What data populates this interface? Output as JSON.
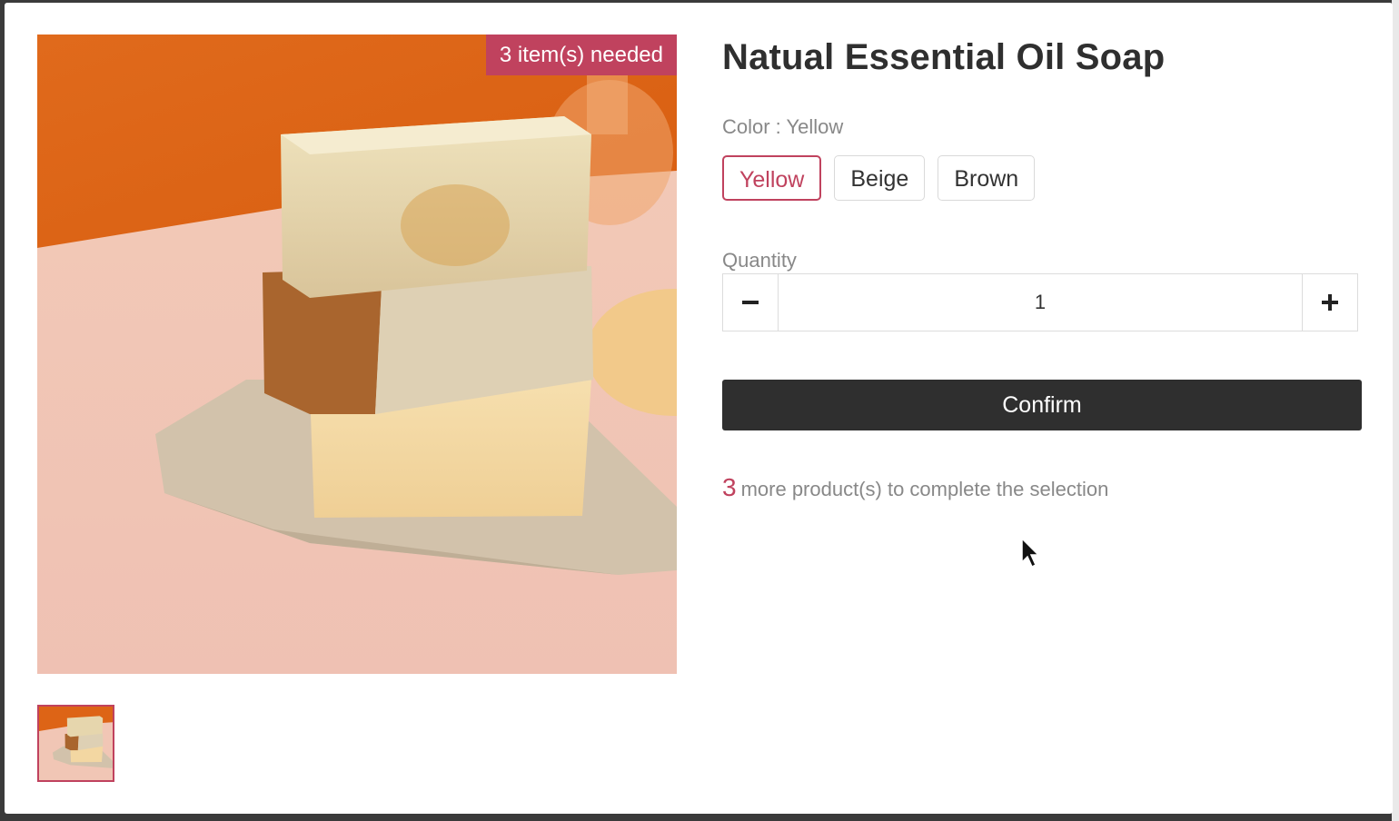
{
  "product": {
    "title": "Natual Essential Oil Soap",
    "badge": "3 item(s) needed",
    "image_alt": "soap-stack-image"
  },
  "color": {
    "label": "Color : Yellow",
    "options": [
      "Yellow",
      "Beige",
      "Brown"
    ],
    "selected": "Yellow"
  },
  "quantity": {
    "label": "Quantity",
    "value": "1",
    "minus_icon": "minus-icon",
    "plus_icon": "plus-icon"
  },
  "confirm": {
    "label": "Confirm"
  },
  "selection": {
    "remaining_count": "3",
    "remaining_text": "more product(s) to complete the selection"
  },
  "colors": {
    "accent": "#c0425e",
    "button_dark": "#2f2f2f",
    "muted_text": "#888888"
  }
}
